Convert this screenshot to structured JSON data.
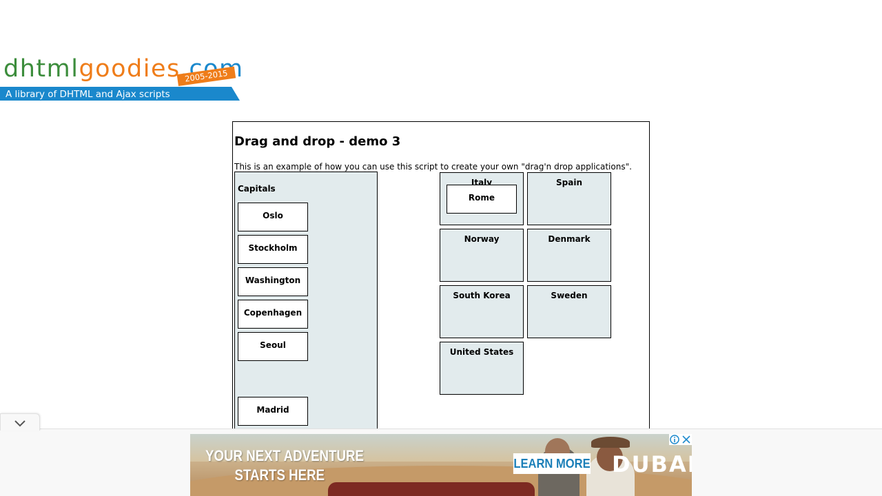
{
  "logo": {
    "part_dhtml": "dhtml",
    "part_goodies": "goodies",
    "part_com": ".com",
    "tagline": "A library of DHTML and Ajax scripts",
    "years": "2005-2015",
    "colors": {
      "green": "#3c8d3c",
      "orange": "#ef7d1a",
      "blue": "#1a88cc"
    }
  },
  "demo": {
    "title": "Drag and drop - demo 3",
    "intro": "This is an example of how you can use this script to create your own \"drag'n drop applications\".",
    "capitals_panel": {
      "title": "Capitals",
      "items": [
        "Oslo",
        "Stockholm",
        "Washington",
        "Copenhagen",
        "Seoul",
        "Madrid"
      ]
    },
    "countries": [
      {
        "name": "Italy",
        "dropped_capital": "Rome"
      },
      {
        "name": "Spain"
      },
      {
        "name": "Norway"
      },
      {
        "name": "Denmark"
      },
      {
        "name": "South Korea"
      },
      {
        "name": "Sweden"
      },
      {
        "name": "United States"
      }
    ]
  },
  "ad": {
    "headline_line1": "YOUR NEXT ADVENTURE",
    "headline_line2": "STARTS HERE",
    "cta": "LEARN MORE",
    "brand": "DUBAI",
    "collapse_icon": "chevron-down-icon",
    "adchoices_icon": "info-icon",
    "close_icon": "close-icon"
  }
}
